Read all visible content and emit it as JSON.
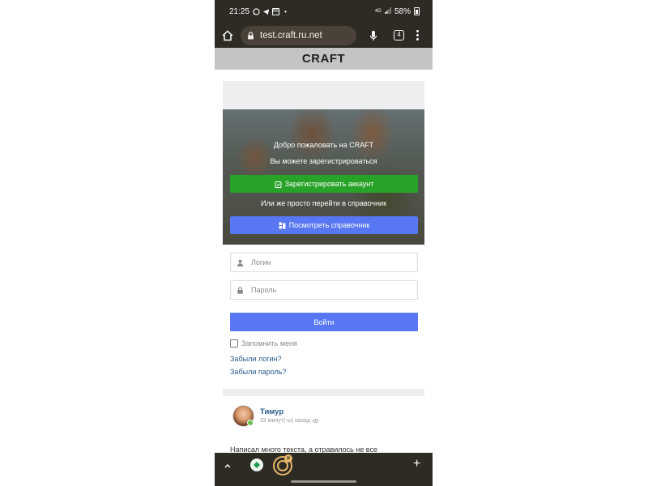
{
  "status_bar": {
    "time": "21:25",
    "battery": "58%",
    "icons": [
      "whatsapp-icon",
      "telegram-icon",
      "notification-icon",
      "dot-icon",
      "network-icon",
      "signal-icon",
      "battery-icon"
    ],
    "small_icon_label": "BR",
    "dot": "•",
    "network_label": "4G"
  },
  "browser": {
    "url": "test.craft.ru.net",
    "tabs_count": "4"
  },
  "site": {
    "logo": "CRAFT"
  },
  "hero": {
    "welcome": "Добро пожаловать на CRAFT",
    "register_prompt": "Вы можете зарегистрироваться",
    "register_button": "Зарегистрировать аккаунт",
    "or_text": "Или же просто перейти в справочник",
    "directory_button": "Посмотреть справочник"
  },
  "login_form": {
    "login_placeholder": "Логин",
    "password_placeholder": "Пароль",
    "submit_label": "Войти",
    "remember_label": "Запомнить меня",
    "forgot_login": "Забыли логин?",
    "forgot_password": "Забыли пароль?"
  },
  "post": {
    "author": "Тимур",
    "time_ago": "33 минут(-ы) назад",
    "text": "Написал много текста, а отравилось не все"
  },
  "colors": {
    "green_button": "#27a328",
    "blue_button": "#5877f2",
    "link": "#2a5a8c",
    "browser_chrome": "#2e2a24"
  }
}
